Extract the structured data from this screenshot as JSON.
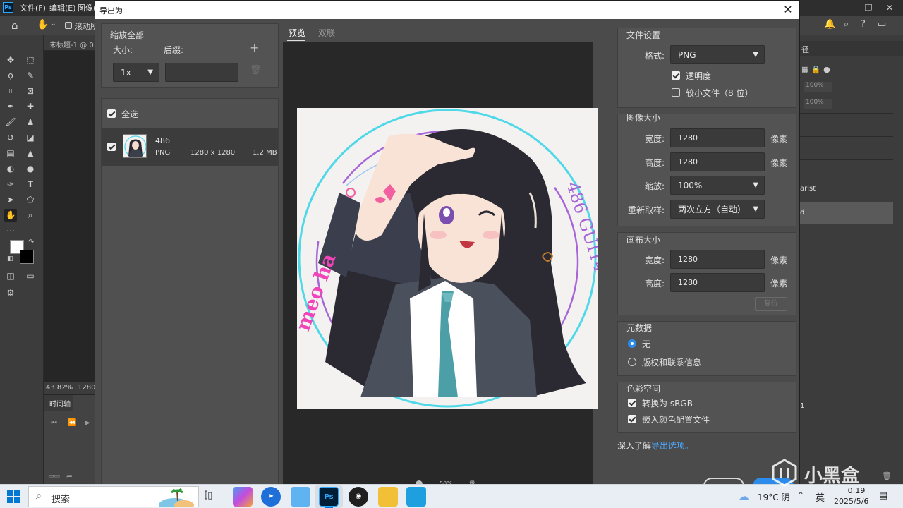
{
  "ps": {
    "logo": "Ps",
    "menu": [
      "文件(F)",
      "编辑(E)",
      "图像("
    ],
    "option_scroll": "滚动所",
    "doc_tab": "未标题-1 @ 0.",
    "zoom": "43.82%",
    "zoom_suffix": "1280",
    "timeline": "时间轴",
    "right_panel": {
      "tab": "径",
      "opacity1": "100%",
      "opacity2": "100%",
      "item1": "arist",
      "item2": "d",
      "item3": "1"
    }
  },
  "dialog": {
    "title": "导出为",
    "scale_panel": {
      "title": "缩放全部",
      "size_label": "大小:",
      "suffix_label": "后缀:",
      "scale_value": "1x",
      "suffix_value": ""
    },
    "select_all": "全选",
    "asset": {
      "name": "486",
      "format": "PNG",
      "dimensions": "1280 x 1280",
      "filesize": "1.2 MB"
    },
    "tabs": {
      "preview": "预览",
      "twoup": "双联"
    },
    "file_settings": {
      "title": "文件设置",
      "format_label": "格式:",
      "format_value": "PNG",
      "transparency": "透明度",
      "smaller_file": "较小文件（8 位）"
    },
    "image_size": {
      "title": "图像大小",
      "width_label": "宽度:",
      "width_value": "1280",
      "height_label": "高度:",
      "height_value": "1280",
      "scale_label": "缩放:",
      "scale_value": "100%",
      "resample_label": "重新取样:",
      "resample_value": "两次立方（自动）",
      "unit": "像素"
    },
    "canvas_size": {
      "title": "画布大小",
      "width_label": "宽度:",
      "width_value": "1280",
      "height_label": "高度:",
      "height_value": "1280",
      "unit": "像素",
      "reset": "复位"
    },
    "metadata": {
      "title": "元数据",
      "none": "无",
      "copyright": "版权和联系信息"
    },
    "color_space": {
      "title": "色彩空间",
      "convert": "转换为 sRGB",
      "embed": "嵌入颜色配置文件"
    },
    "learn_more": "深入了解",
    "learn_link": "导出选项。",
    "preview_art": {
      "text_left": "meo ha",
      "text_right": "486 GUIT4"
    },
    "zoom_value": "50%"
  },
  "taskbar": {
    "search": "搜索",
    "weather": "19°C 阴",
    "lang": "英",
    "time": "0:19",
    "date": "2025/5/6",
    "watermark": "小黑盒"
  },
  "colors": {
    "accent": "#2d8ceb",
    "ring": "#4fd8e8",
    "link": "#4ba8ff"
  }
}
